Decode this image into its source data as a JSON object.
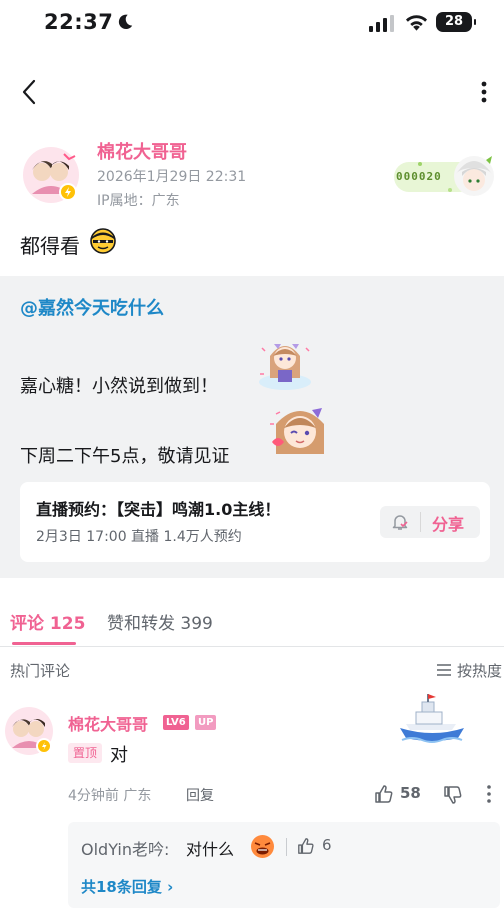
{
  "status_bar": {
    "time": "22:37",
    "battery": "28"
  },
  "post": {
    "author": "棉花大哥哥",
    "time": "2026年1月29日 22:31",
    "ip": "IP属地：广东",
    "fan_badge_no": "000020",
    "text": "都得看"
  },
  "repost": {
    "mention": "@嘉然今天吃什么",
    "line1": "嘉心糖！小然说到做到！",
    "line2": "下周二下午5点，敬请见证",
    "live_card": {
      "title": "直播预约：【突击】鸣潮1.0主线！",
      "meta": "2月3日 17:00 直播   1.4万人预约",
      "share": "分享"
    }
  },
  "tabs": {
    "comments": "评论 125",
    "reposts": "赞和转发 399"
  },
  "comments": {
    "section_title": "热门评论",
    "sort_label": "按热度",
    "top": {
      "author": "棉花大哥哥",
      "level": "LV6",
      "up": "UP",
      "pin": "置顶",
      "text": "对",
      "meta": "4分钟前 广东",
      "reply": "回复",
      "likes": "58",
      "sub": {
        "author": "OldYin老吟:",
        "text": "对什么",
        "likes": "6",
        "more": "共18条回复 ›"
      }
    }
  },
  "colors": {
    "accent": "#f06292",
    "link": "#1e88c7"
  }
}
